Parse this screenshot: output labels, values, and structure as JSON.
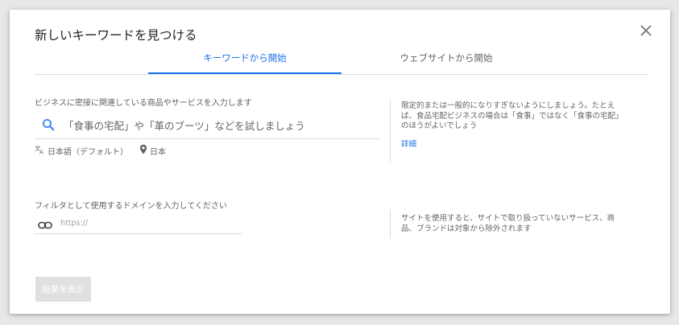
{
  "dialog": {
    "title": "新しいキーワードを見つける",
    "tabs": [
      {
        "label": "キーワードから開始",
        "active": true
      },
      {
        "label": "ウェブサイトから開始",
        "active": false
      }
    ]
  },
  "keywords": {
    "label": "ビジネスに密接に関連している商品やサービスを入力します",
    "placeholder": "「食事の宅配」や「革のブーツ」などを試しましょう",
    "language": "日本語（デフォルト）",
    "location": "日本",
    "help": [
      "限定的または一般的になりすぎないようにしましょう。たとえ",
      "ば、食品宅配ビジネスの場合は「食事」ではなく「食事の宅配」",
      "のほうがよいでしょう"
    ],
    "details_link": "詳細"
  },
  "domain": {
    "label": "フィルタとして使用するドメインを入力してください",
    "placeholder": "https://",
    "help": [
      "サイトを使用すると、サイトで取り扱っていないサービス、商",
      "品、ブランドは対象から除外されます"
    ]
  },
  "submit_label": "結果を表示",
  "colors": {
    "accent": "#1a73e8",
    "disabled_button": "#e0e0e0",
    "divider": "#dadce0"
  }
}
